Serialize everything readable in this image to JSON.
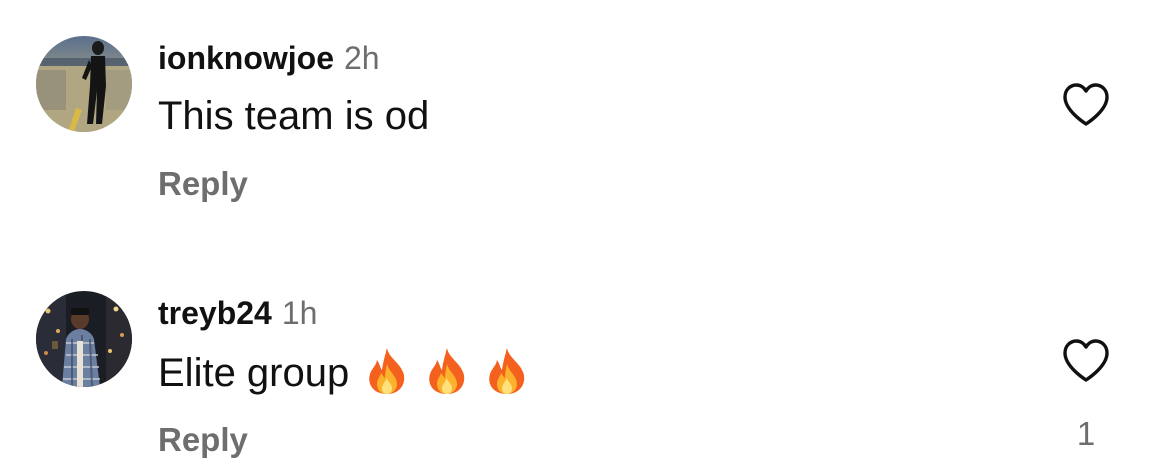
{
  "comments": [
    {
      "username": "ionknowjoe",
      "time": "2h",
      "text": "This team is od",
      "emojis": [],
      "reply_label": "Reply",
      "like_icon": "heart-outline-icon",
      "like_count": ""
    },
    {
      "username": "treyb24",
      "time": "1h",
      "text": "Elite group",
      "emojis": [
        "fire-emoji",
        "fire-emoji",
        "fire-emoji"
      ],
      "reply_label": "Reply",
      "like_icon": "heart-outline-icon",
      "like_count": "1"
    }
  ],
  "colors": {
    "primary_text": "#111111",
    "secondary_text": "#6e6e6e",
    "background": "#ffffff"
  }
}
